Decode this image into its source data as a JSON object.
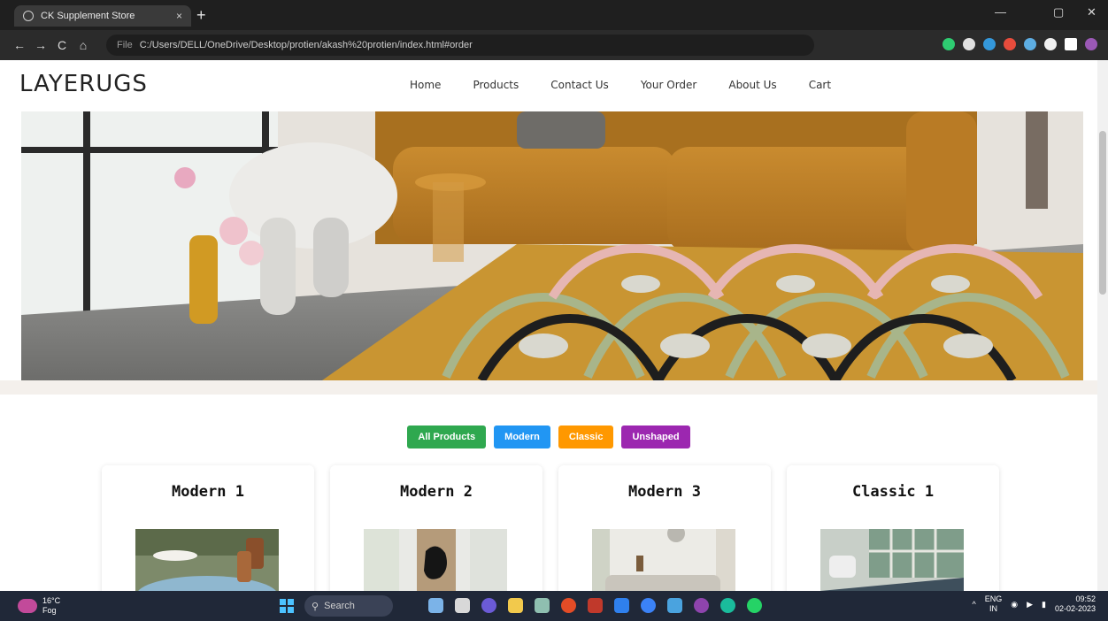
{
  "browser": {
    "tab_title": "CK Supplement Store",
    "tab_close": "×",
    "new_tab": "+",
    "file_label": "File",
    "url": "C:/Users/DELL/OneDrive/Desktop/protien/akash%20protien/index.html#order",
    "window_controls": {
      "minimize": "—",
      "maximize": "▢",
      "close": "✕"
    },
    "nav": {
      "back": "←",
      "forward": "→",
      "reload": "C",
      "home": "⌂"
    }
  },
  "site": {
    "logo": "LAYERUGS",
    "menu": [
      "Home",
      "Products",
      "Contact Us",
      "Your Order",
      "About Us",
      "Cart"
    ]
  },
  "filters": [
    {
      "label": "All Products",
      "color": "#2fa84f"
    },
    {
      "label": "Modern",
      "color": "#2196f3"
    },
    {
      "label": "Classic",
      "color": "#ff9800"
    },
    {
      "label": "Unshaped",
      "color": "#9c27b0"
    }
  ],
  "products": [
    {
      "title": "Modern 1",
      "image": "patio-rug-image"
    },
    {
      "title": "Modern 2",
      "image": "hallway-art-image"
    },
    {
      "title": "Modern 3",
      "image": "living-room-image"
    },
    {
      "title": "Classic 1",
      "image": "classic-room-image"
    }
  ],
  "taskbar": {
    "weather_temp": "16°C",
    "weather_desc": "Fog",
    "search": "Search",
    "lang": "ENG",
    "region": "IN",
    "time": "09:52",
    "date": "02-02-2023"
  }
}
